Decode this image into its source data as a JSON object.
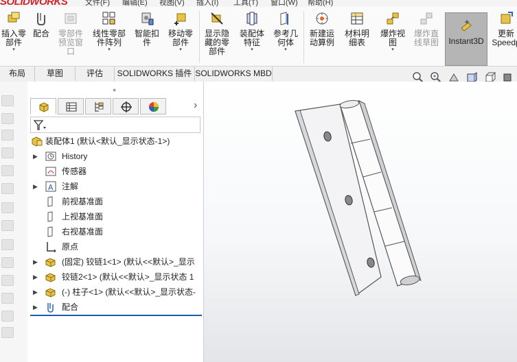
{
  "app": {
    "logo_text": "SOLIDWORKS",
    "brand_color": "#d2232a"
  },
  "menubar": {
    "items": [
      "文件(F)",
      "编辑(E)",
      "视图(V)",
      "插入(I)",
      "工具(T)",
      "窗口(W)",
      "帮助(H)"
    ]
  },
  "ribbon": {
    "buttons": [
      {
        "label": "插入零\n部件",
        "icon": "insert-component-icon",
        "dropdown": true,
        "enabled": true
      },
      {
        "label": "配合",
        "icon": "mate-icon",
        "dropdown": false,
        "enabled": true
      },
      {
        "label": "零部件\n预览窗\n口",
        "icon": "component-preview-icon",
        "dropdown": false,
        "enabled": false
      },
      {
        "label": "线性零部\n件阵列",
        "icon": "linear-pattern-icon",
        "dropdown": true,
        "enabled": true
      },
      {
        "label": "智能扣\n件",
        "icon": "smart-fasteners-icon",
        "dropdown": false,
        "enabled": true
      },
      {
        "label": "移动零\n部件",
        "icon": "move-component-icon",
        "dropdown": true,
        "enabled": true
      },
      {
        "label": "显示隐\n藏的零\n部件",
        "icon": "show-hidden-icon",
        "dropdown": false,
        "enabled": true
      },
      {
        "label": "装配体\n特征",
        "icon": "assembly-features-icon",
        "dropdown": true,
        "enabled": true
      },
      {
        "label": "参考几\n何体",
        "icon": "reference-geometry-icon",
        "dropdown": true,
        "enabled": true
      },
      {
        "label": "新建运\n动算例",
        "icon": "new-motion-study-icon",
        "dropdown": false,
        "enabled": true
      },
      {
        "label": "材料明\n细表",
        "icon": "bom-icon",
        "dropdown": false,
        "enabled": true
      },
      {
        "label": "爆炸视\n图",
        "icon": "exploded-view-icon",
        "dropdown": true,
        "enabled": true
      },
      {
        "label": "爆炸直\n线草图",
        "icon": "explode-line-sketch-icon",
        "dropdown": false,
        "enabled": false
      },
      {
        "label": "Instant3D",
        "icon": "instant3d-icon",
        "dropdown": false,
        "enabled": true,
        "active": true
      },
      {
        "label": "更新\nSpeedp",
        "icon": "update-speedpak-icon",
        "dropdown": false,
        "enabled": true
      }
    ]
  },
  "tabs": [
    {
      "label": "布局",
      "active": false
    },
    {
      "label": "草图",
      "active": false
    },
    {
      "label": "评估",
      "active": false
    },
    {
      "label": "SOLIDWORKS 插件",
      "active": false
    },
    {
      "label": "SOLIDWORKS MBD",
      "active": false
    }
  ],
  "panel": {
    "tab_icons": [
      "feature-manager-icon",
      "property-manager-icon",
      "configuration-manager-icon",
      "dimxpert-icon",
      "display-manager-icon"
    ],
    "more_arrow": "›",
    "filter_icon": "filter-icon",
    "tree": [
      {
        "label": "装配体1  (默认<默认_显示状态-1>)",
        "icon": "assembly-icon",
        "expandable": false
      },
      {
        "label": "History",
        "icon": "history-icon",
        "expandable": true
      },
      {
        "label": "传感器",
        "icon": "sensor-icon",
        "expandable": false
      },
      {
        "label": "注解",
        "icon": "annotation-icon",
        "expandable": true
      },
      {
        "label": "前视基准面",
        "icon": "plane-icon",
        "expandable": false
      },
      {
        "label": "上视基准面",
        "icon": "plane-icon",
        "expandable": false
      },
      {
        "label": "右视基准面",
        "icon": "plane-icon",
        "expandable": false
      },
      {
        "label": "原点",
        "icon": "origin-icon",
        "expandable": false
      },
      {
        "label": "(固定) 铰链1<1>  (默认<<默认>_显示",
        "icon": "part-icon",
        "expandable": true
      },
      {
        "label": "铰链2<1>  (默认<<默认>_显示状态 1",
        "icon": "part-icon",
        "expandable": true
      },
      {
        "label": "(-) 柱子<1>  (默认<<默认>_显示状态-",
        "icon": "part-icon",
        "expandable": true
      },
      {
        "label": "配合",
        "icon": "mates-icon",
        "expandable": true
      }
    ]
  },
  "hud": {
    "icons": [
      "zoom-to-fit-icon",
      "zoom-to-area-icon",
      "previous-view-icon",
      "section-view-icon",
      "view-orientation-icon"
    ]
  }
}
